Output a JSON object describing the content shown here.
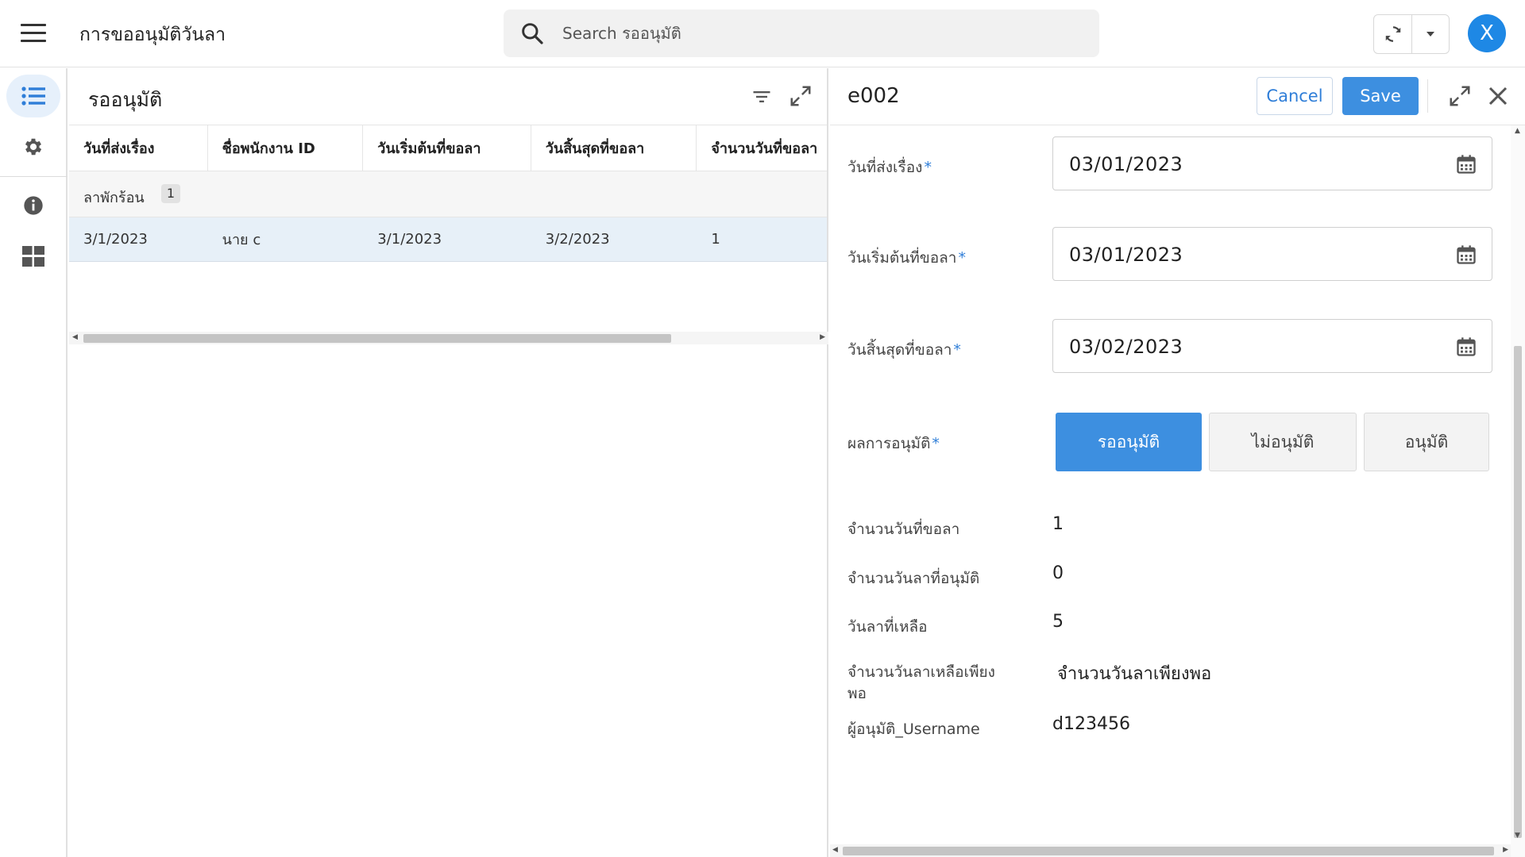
{
  "app": {
    "title": "การขออนุมัติวันลา",
    "search_placeholder": "Search รออนุมัติ",
    "avatar_initial": "X"
  },
  "rail": {
    "items": [
      {
        "icon": "list-icon",
        "active": true
      },
      {
        "icon": "gear-icon",
        "active": false
      },
      {
        "icon": "info-icon",
        "active": false
      },
      {
        "icon": "dashboard-icon",
        "active": false
      }
    ]
  },
  "list": {
    "title": "รออนุมัติ",
    "columns": [
      "วันที่ส่งเรื่อง",
      "ชื่อพนักงาน ID",
      "วันเริ่มต้นที่ขอลา",
      "วันสิ้นสุดที่ขอลา",
      "จำนวนวันที่ขอลา"
    ],
    "group": {
      "label": "ลาพักร้อน",
      "count": "1"
    },
    "rows": [
      [
        "3/1/2023",
        "นาย c",
        "3/1/2023",
        "3/2/2023",
        "1"
      ]
    ]
  },
  "detail": {
    "record_id": "e002",
    "cancel_label": "Cancel",
    "save_label": "Save",
    "fields": {
      "submit_date": {
        "label": "วันที่ส่งเรื่อง",
        "value": "03/01/2023"
      },
      "start_date": {
        "label": "วันเริ่มต้นที่ขอลา",
        "value": "03/01/2023"
      },
      "end_date": {
        "label": "วันสิ้นสุดที่ขอลา",
        "value": "03/02/2023"
      },
      "approval_result": {
        "label": "ผลการอนุมัติ",
        "options": [
          "รออนุมัติ",
          "ไม่อนุมัติ",
          "อนุมัติ"
        ],
        "selected": "รออนุมัติ"
      },
      "days_requested": {
        "label": "จำนวนวันที่ขอลา",
        "value": "1"
      },
      "days_approved": {
        "label": "จำนวนวันลาที่อนุมัติ",
        "value": "0"
      },
      "days_remaining": {
        "label": "วันลาที่เหลือ",
        "value": "5"
      },
      "sufficient": {
        "label_line1": "จำนวนวันลาเหลือเพียง",
        "label_line2": "พอ",
        "value": "จำนวนวันลาเพียงพอ"
      },
      "approver": {
        "label": "ผู้อนุมัติ_Username",
        "value": "d123456"
      }
    }
  },
  "colors": {
    "accent": "#3d8fe0",
    "selected_row": "#e7f0f8",
    "avatar": "#1e88e5"
  }
}
